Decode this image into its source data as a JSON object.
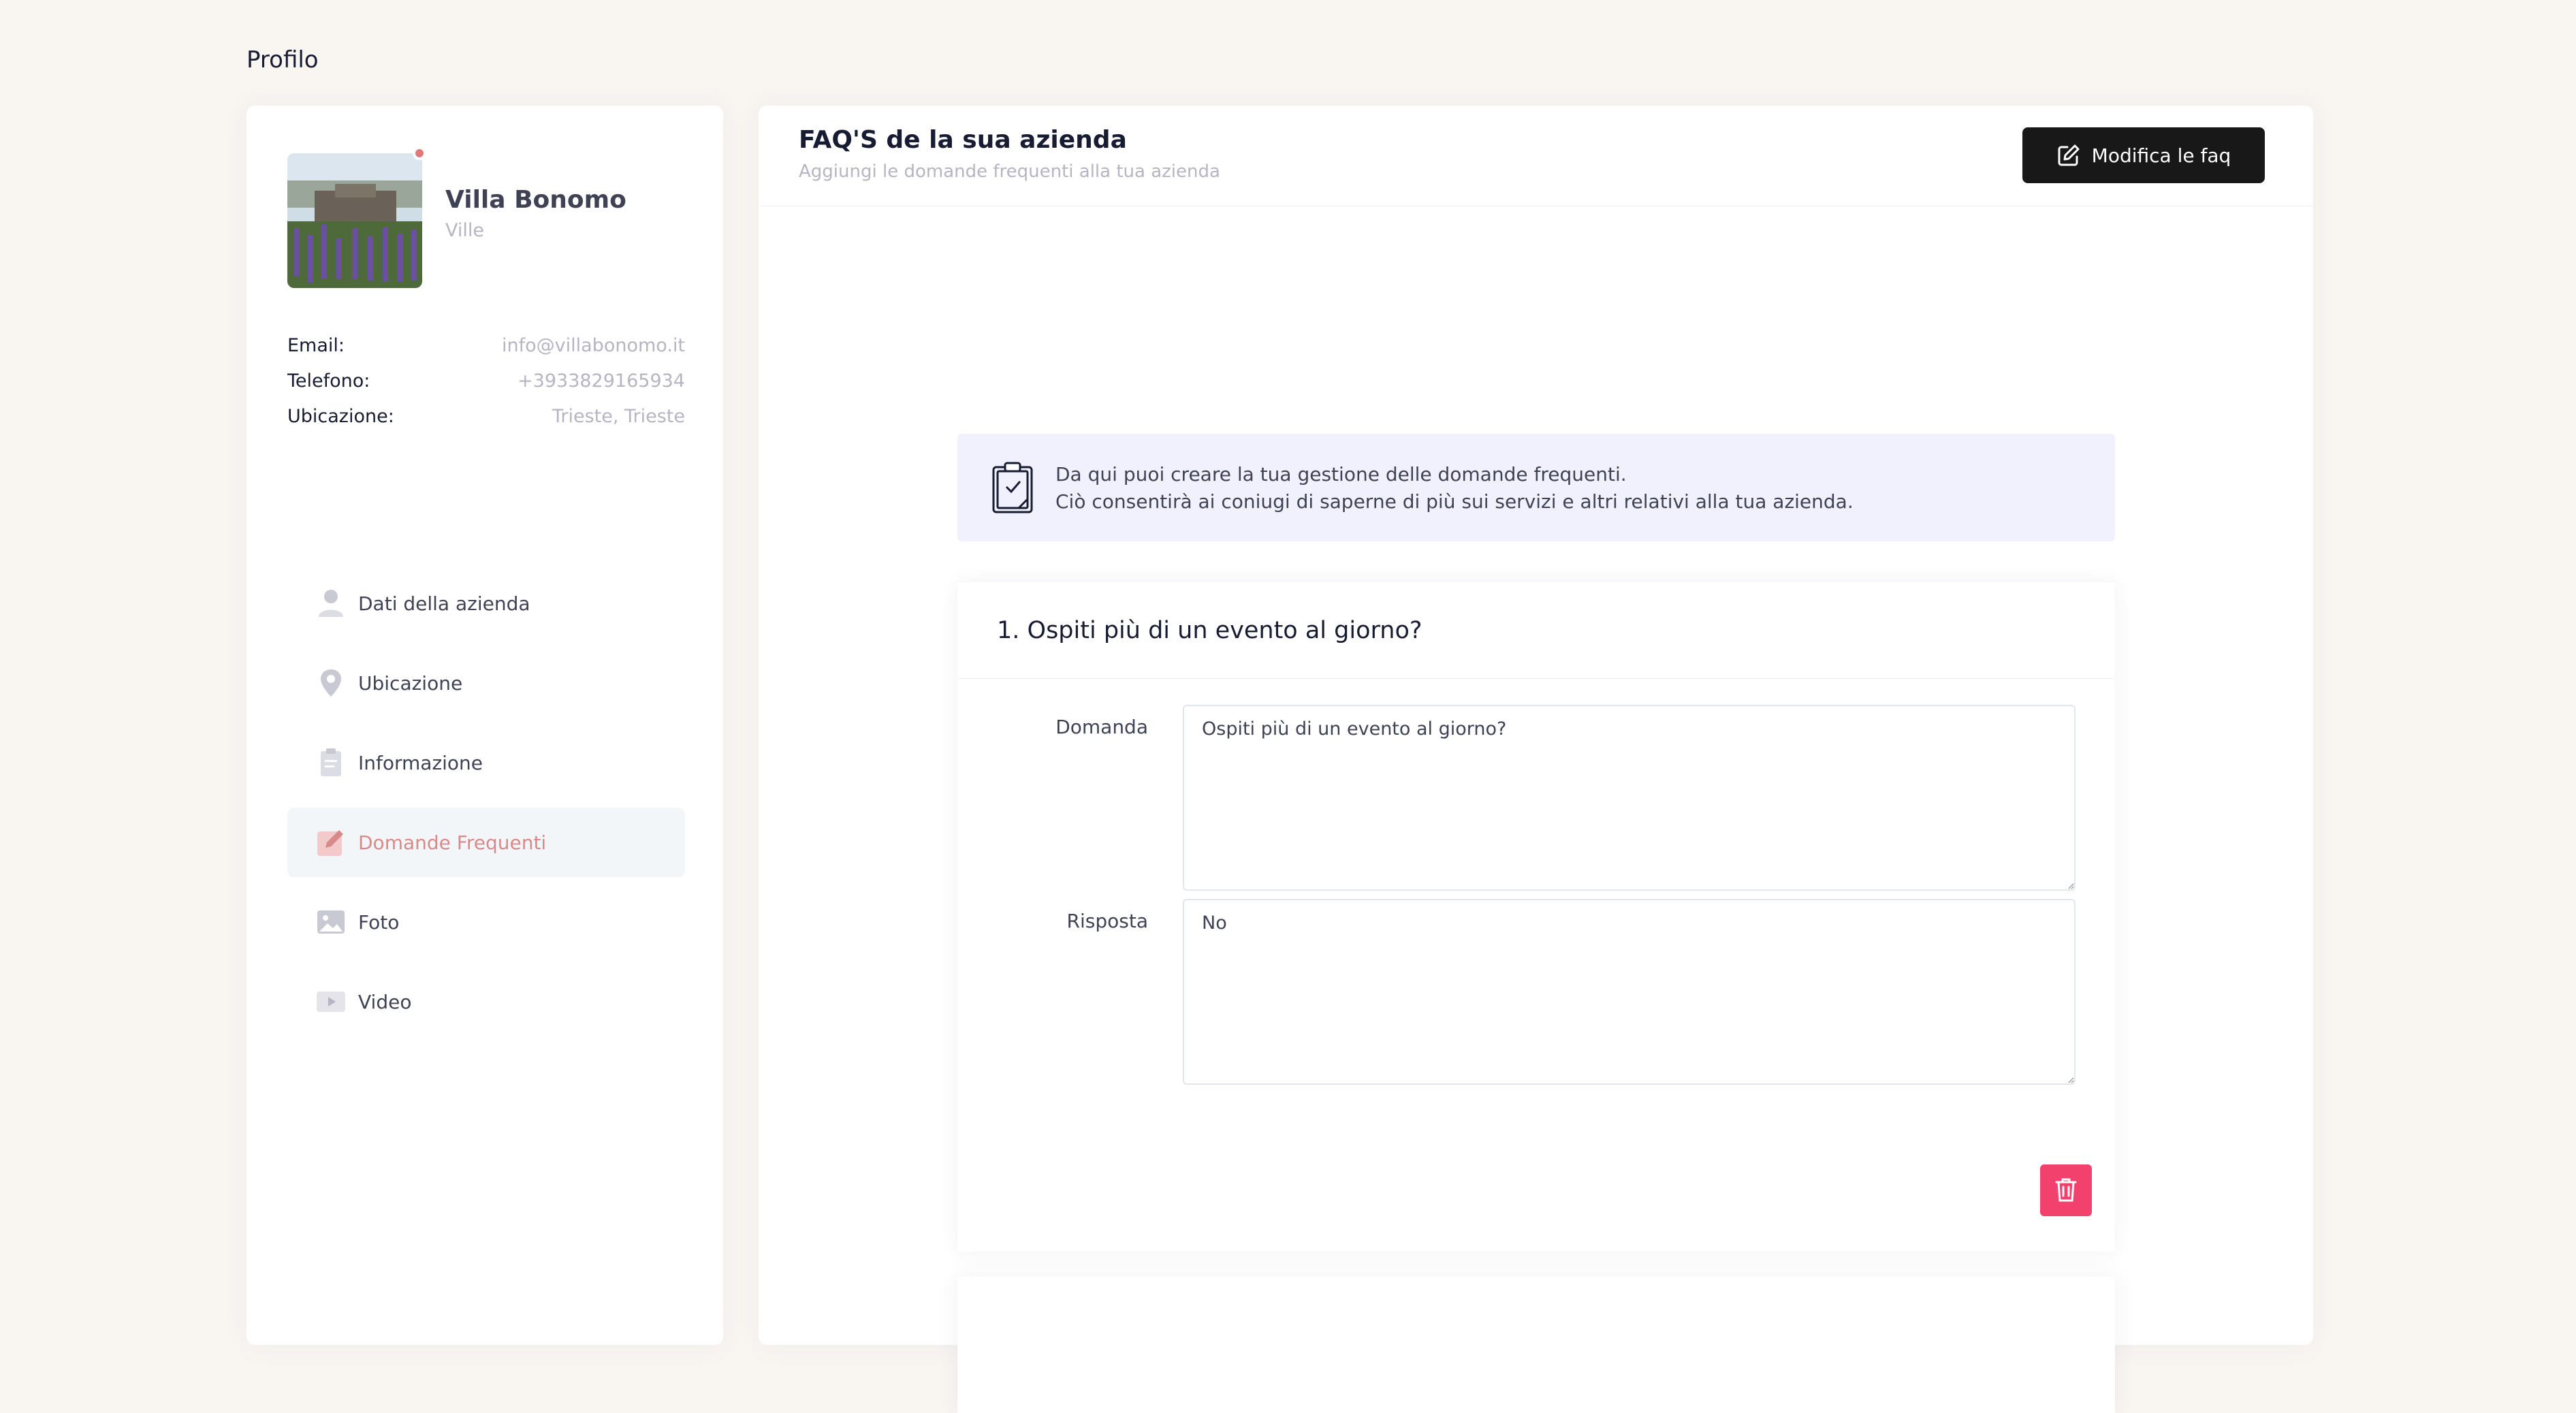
{
  "page": {
    "heading": "Profilo"
  },
  "profile": {
    "name": "Villa Bonomo",
    "type": "Ville",
    "status_color": "#e07a7a",
    "info": [
      {
        "label": "Email:",
        "value": "info@villabonomo.it"
      },
      {
        "label": "Telefono:",
        "value": "+3933829165934"
      },
      {
        "label": "Ubicazione:",
        "value": "Trieste, Trieste"
      }
    ]
  },
  "nav": {
    "items": [
      {
        "label": "Dati della azienda",
        "icon": "user-icon",
        "active": false
      },
      {
        "label": "Ubicazione",
        "icon": "location-pin-icon",
        "active": false
      },
      {
        "label": "Informazione",
        "icon": "clipboard-icon",
        "active": false
      },
      {
        "label": "Domande Frequenti",
        "icon": "edit-icon",
        "active": true
      },
      {
        "label": "Foto",
        "icon": "image-icon",
        "active": false
      },
      {
        "label": "Video",
        "icon": "video-icon",
        "active": false
      }
    ],
    "active_color": "#d88a8a"
  },
  "faq": {
    "title": "FAQ'S de la sua azienda",
    "subtitle": "Aggiungi le domande frequenti alla tua azienda",
    "edit_button_label": "Modifica le faq",
    "notice": {
      "line1": "Da qui puoi creare la tua gestione delle domande frequenti.",
      "line2": "Ciò consentirà ai coniugi di saperne di più sui servizi e altri relativi alla tua azienda."
    },
    "items": [
      {
        "heading": "1. Ospiti più di un evento al giorno?",
        "question_label": "Domanda",
        "question_value": "Ospiti più di un evento al giorno?",
        "answer_label": "Risposta",
        "answer_value": "No"
      }
    ],
    "delete_color": "#f1416c"
  }
}
